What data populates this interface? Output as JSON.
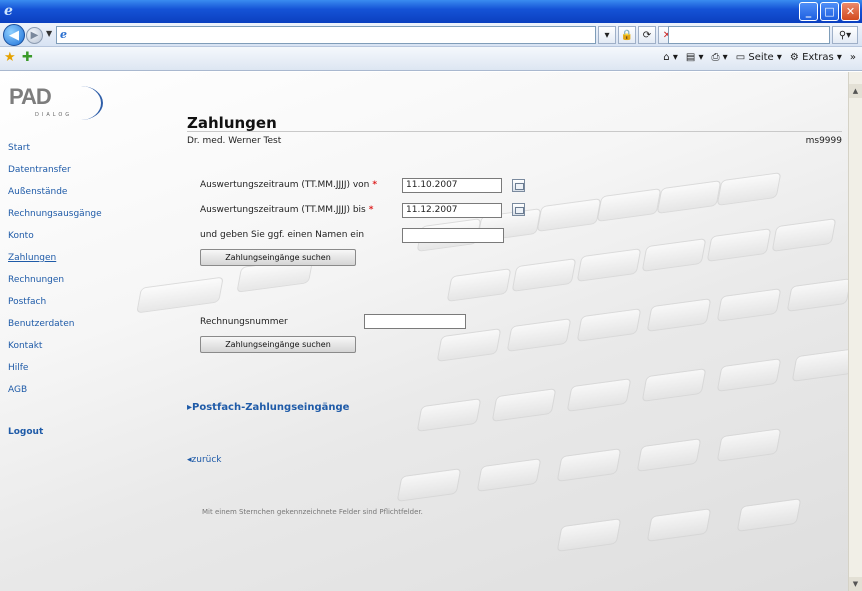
{
  "browser": {
    "address": "",
    "search_text": "",
    "commands": {
      "page": "Seite",
      "extras": "Extras"
    }
  },
  "logo": {
    "brand": "PAD",
    "sub": "DIALOG"
  },
  "sidebar": {
    "items": [
      {
        "label": "Start"
      },
      {
        "label": "Datentransfer"
      },
      {
        "label": "Außenstände"
      },
      {
        "label": "Rechnungsausgänge"
      },
      {
        "label": "Konto"
      },
      {
        "label": "Zahlungen"
      },
      {
        "label": "Rechnungen"
      },
      {
        "label": "Postfach"
      },
      {
        "label": "Benutzerdaten"
      },
      {
        "label": "Kontakt"
      },
      {
        "label": "Hilfe"
      },
      {
        "label": "AGB"
      }
    ],
    "logout": "Logout"
  },
  "main": {
    "title": "Zahlungen",
    "user_name": "Dr. med. Werner Test",
    "user_id": "ms9999",
    "form1": {
      "from_label": "Auswertungszeitraum (TT.MM.JJJJ) von",
      "from_value": "11.10.2007",
      "to_label": "Auswertungszeitraum (TT.MM.JJJJ) bis",
      "to_value": "11.12.2007",
      "name_label": "und geben Sie ggf. einen Namen ein",
      "name_value": "",
      "search_label": "Zahlungseingänge suchen"
    },
    "form2": {
      "number_label": "Rechnungsnummer",
      "number_value": "",
      "search_label": "Zahlungseingänge suchen"
    },
    "postfach_link": "Postfach-Zahlungseingänge",
    "back_link": "zurück",
    "footnote": "Mit einem Sternchen gekennzeichnete Felder sind Pflichtfelder.",
    "required_marker": "*"
  },
  "colors": {
    "link": "#1f5ba8",
    "required": "#dd2222",
    "titlebar": "#1553d6"
  }
}
